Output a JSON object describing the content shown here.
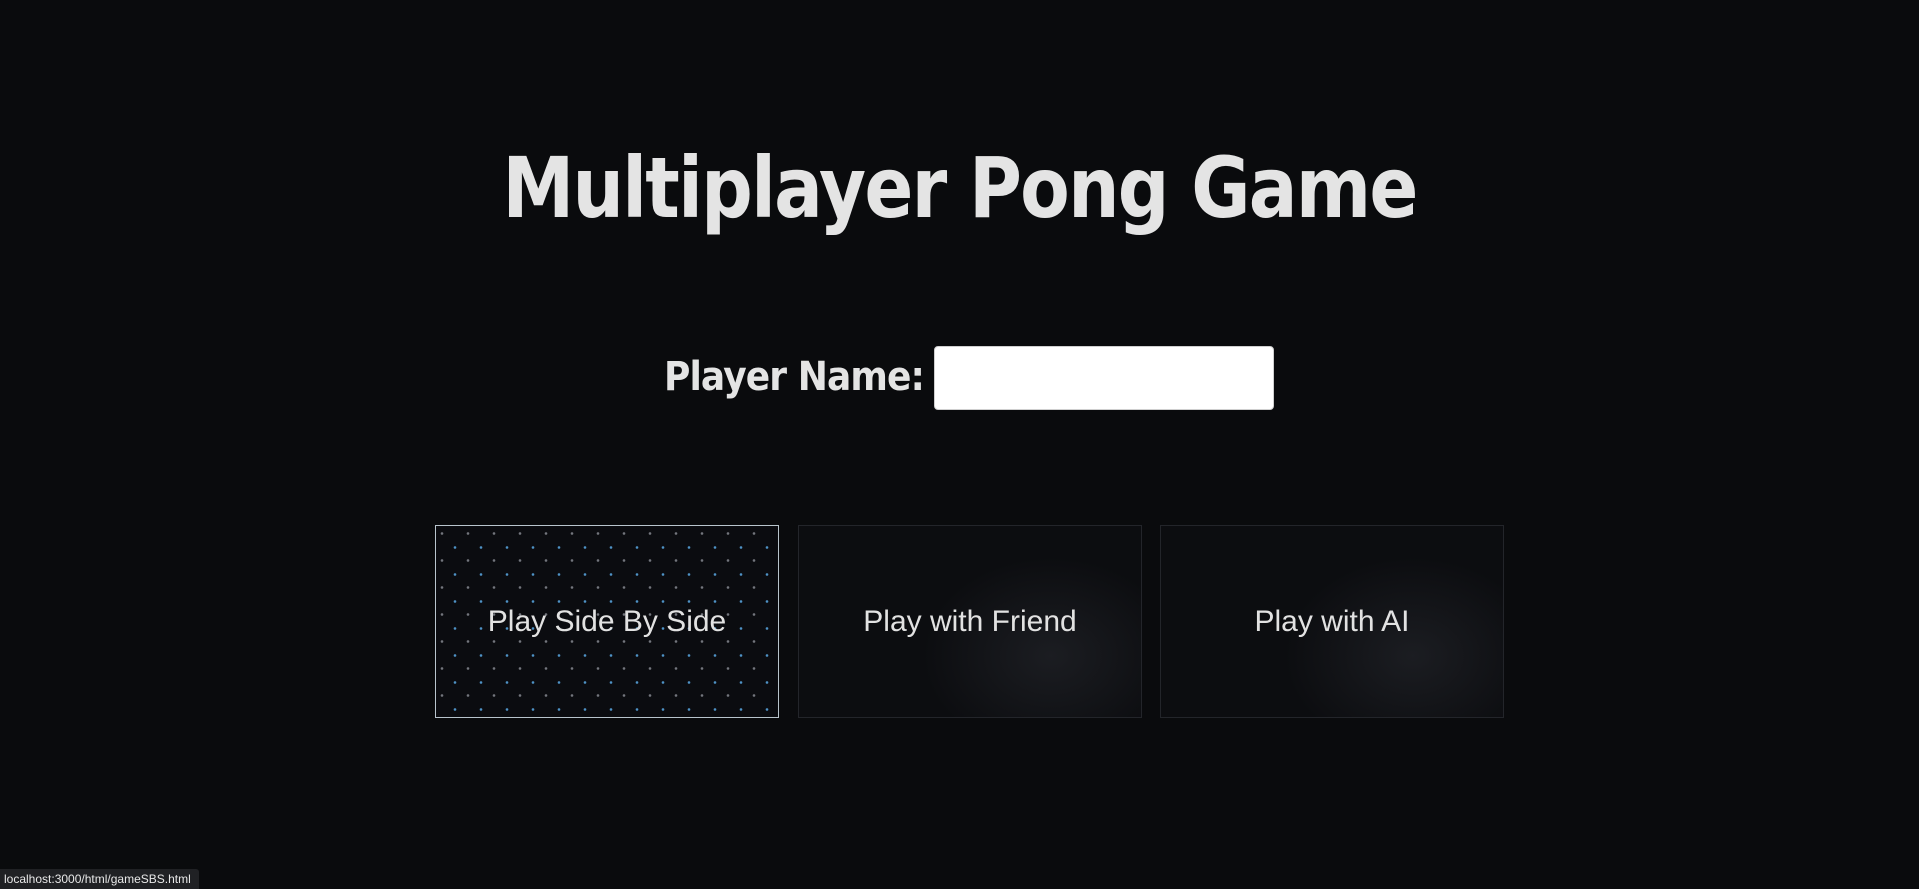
{
  "title": "Multiplayer Pong Game",
  "player": {
    "label": "Player Name:",
    "value": "",
    "placeholder": ""
  },
  "modes": [
    {
      "label": "Play Side By Side",
      "active": true
    },
    {
      "label": "Play with Friend",
      "active": false
    },
    {
      "label": "Play with AI",
      "active": false
    }
  ],
  "status_bar": {
    "url": "localhost:3000/html/gameSBS.html"
  },
  "colors": {
    "background": "#0a0b0d",
    "text": "#e4e4e4",
    "active_border": "#b8c4cc",
    "dot_accent": "#5aaae6"
  }
}
